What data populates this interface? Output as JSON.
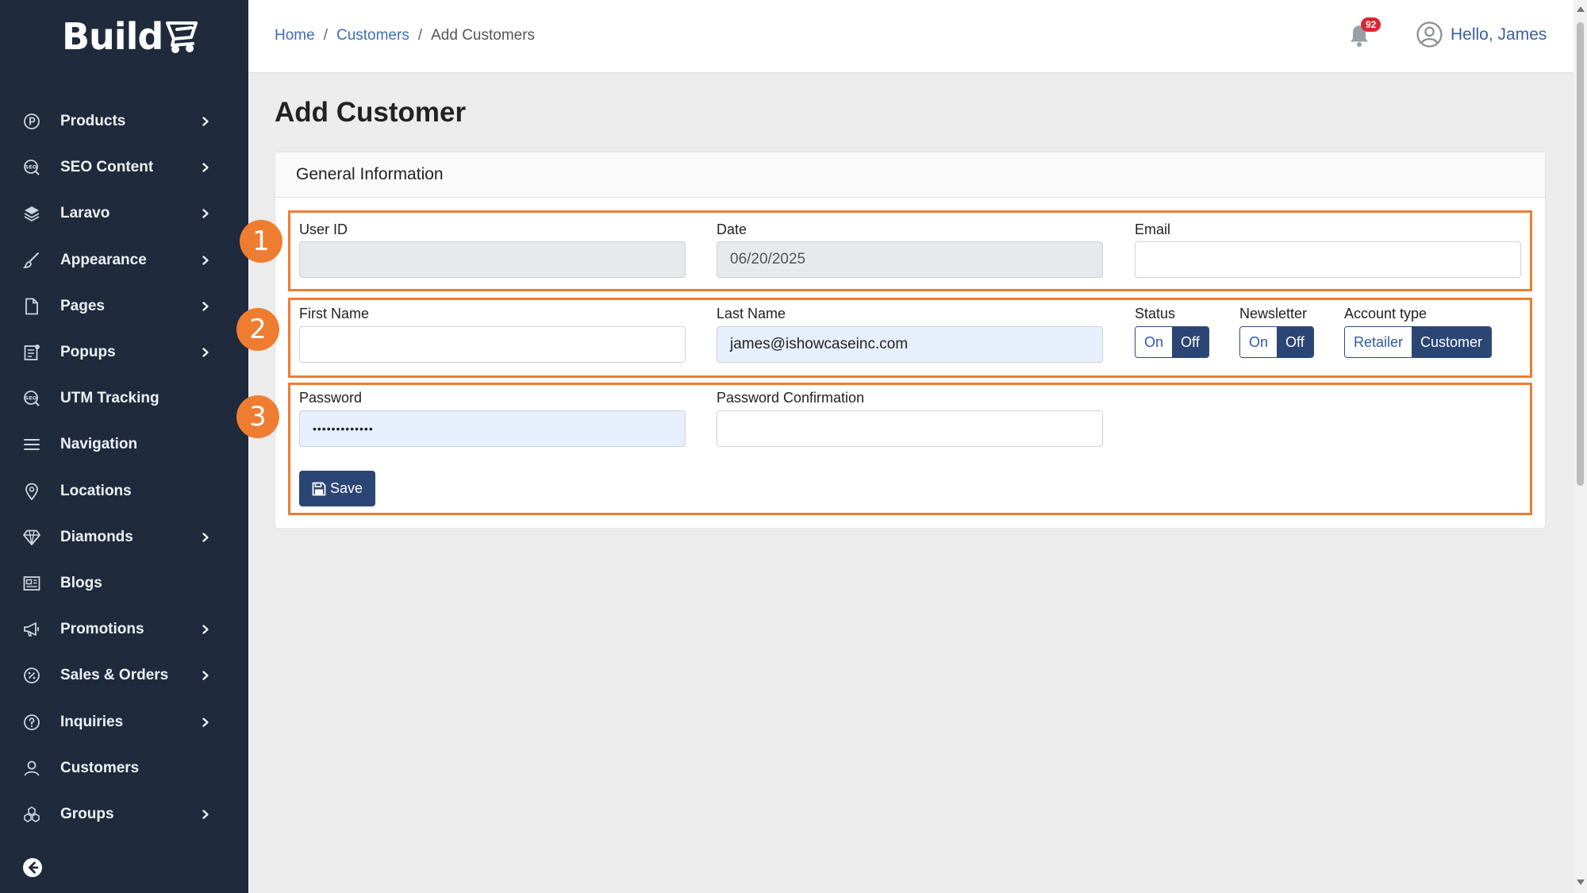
{
  "brand": {
    "name": "Build"
  },
  "sidebar": {
    "items": [
      {
        "label": "Products",
        "icon": "product-icon",
        "chevron": true
      },
      {
        "label": "SEO Content",
        "icon": "seo-icon",
        "chevron": true
      },
      {
        "label": "Laravo",
        "icon": "layers-icon",
        "chevron": true
      },
      {
        "label": "Appearance",
        "icon": "brush-icon",
        "chevron": true
      },
      {
        "label": "Pages",
        "icon": "page-icon",
        "chevron": true
      },
      {
        "label": "Popups",
        "icon": "popup-icon",
        "chevron": true
      },
      {
        "label": "UTM Tracking",
        "icon": "seo-icon",
        "chevron": false
      },
      {
        "label": "Navigation",
        "icon": "menu-icon",
        "chevron": false
      },
      {
        "label": "Locations",
        "icon": "location-pin-icon",
        "chevron": false
      },
      {
        "label": "Diamonds",
        "icon": "diamond-icon",
        "chevron": true
      },
      {
        "label": "Blogs",
        "icon": "newspaper-icon",
        "chevron": false
      },
      {
        "label": "Promotions",
        "icon": "megaphone-icon",
        "chevron": true
      },
      {
        "label": "Sales & Orders",
        "icon": "discount-icon",
        "chevron": true
      },
      {
        "label": "Inquiries",
        "icon": "question-icon",
        "chevron": true
      },
      {
        "label": "Customers",
        "icon": "user-icon",
        "chevron": false
      },
      {
        "label": "Groups",
        "icon": "group-icon",
        "chevron": true
      }
    ]
  },
  "header": {
    "breadcrumb": {
      "home": "Home",
      "customers": "Customers",
      "current": "Add Customers",
      "separator": "/"
    },
    "notifications_count": "92",
    "greeting": "Hello, James"
  },
  "page": {
    "title": "Add Customer",
    "section_title": "General Information",
    "markers": [
      "1",
      "2",
      "3"
    ],
    "fields": {
      "user_id": {
        "label": "User ID",
        "value": ""
      },
      "date": {
        "label": "Date",
        "value": "06/20/2025"
      },
      "email": {
        "label": "Email",
        "value": ""
      },
      "first_name": {
        "label": "First Name",
        "value": ""
      },
      "last_name": {
        "label": "Last Name",
        "value": "james@ishowcaseinc.com"
      },
      "password": {
        "label": "Password",
        "value": "•••••••••••••"
      },
      "password_confirmation": {
        "label": "Password Confirmation",
        "value": ""
      }
    },
    "status": {
      "label": "Status",
      "on": "On",
      "off": "Off",
      "selected": "Off"
    },
    "newsletter": {
      "label": "Newsletter",
      "on": "On",
      "off": "Off",
      "selected": "Off"
    },
    "account_type": {
      "label": "Account type",
      "retailer": "Retailer",
      "customer": "Customer",
      "selected": "Customer"
    },
    "save_label": "Save"
  },
  "colors": {
    "sidebar_bg": "#1f2a3c",
    "accent": "#2b4675",
    "highlight": "#ee7d31",
    "link": "#3b6fb6",
    "badge": "#d9282f"
  }
}
